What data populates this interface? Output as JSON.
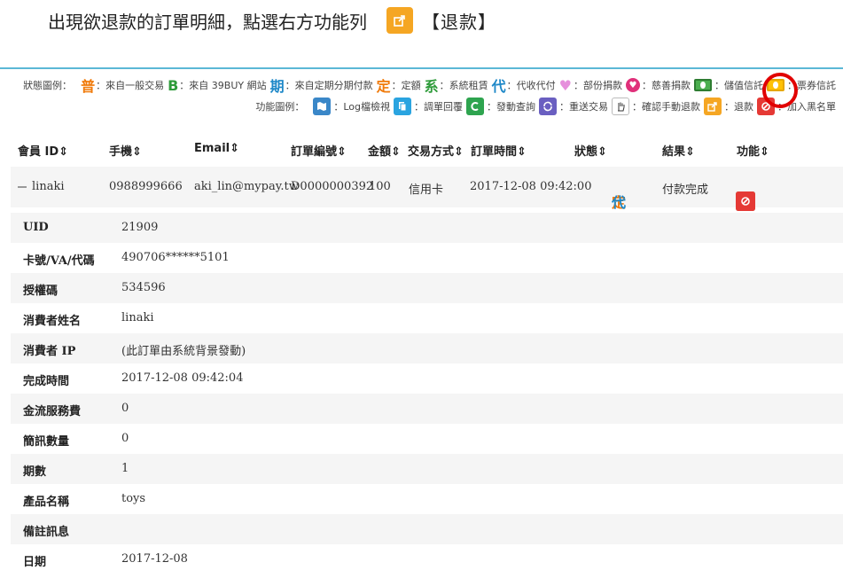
{
  "instruction": {
    "text": "出現欲退款的訂單明細，點選右方功能列",
    "refund_label": "【退款】"
  },
  "legend_status": {
    "label": "狀態圖例：",
    "items": [
      {
        "glyph": "普",
        "color": "#f07a0a",
        "text": "：來自一般交易"
      },
      {
        "glyph": "B",
        "color": "#2e9b3a",
        "text": "：來自 39BUY 網站"
      },
      {
        "glyph": "期",
        "color": "#1e88c8",
        "text": "：來自定期分期付款"
      },
      {
        "glyph": "定",
        "color": "#f07a0a",
        "text": "：定額"
      },
      {
        "glyph": "系",
        "color": "#2e9b3a",
        "text": "：系統租賃"
      },
      {
        "glyph": "代",
        "color": "#1e88c8",
        "text": "：代收代付"
      },
      {
        "glyph": "heart",
        "text": "：部份捐款"
      },
      {
        "glyph": "dot",
        "text": "：慈善捐款"
      },
      {
        "glyph": "money-green",
        "text": "：儲值信託"
      },
      {
        "glyph": "money-yellow",
        "text": "：票券信託"
      }
    ]
  },
  "legend_function": {
    "label": "功能圖例：",
    "items": [
      {
        "icon": "map-icon",
        "color": "#3a87c8",
        "text": "：Log檔檢視"
      },
      {
        "icon": "copy-icon",
        "color": "#2aa4e0",
        "text": "：調單回覆"
      },
      {
        "icon": "refresh-c-icon",
        "color": "#2ea44f",
        "text": "：發動查詢"
      },
      {
        "icon": "resend-icon",
        "color": "#6a5fc1",
        "text": "：重送交易"
      },
      {
        "icon": "hand-icon",
        "color": "#ffffff",
        "text": "：確認手動退款"
      },
      {
        "icon": "share-icon",
        "color": "#f5a623",
        "text": "：退款"
      },
      {
        "icon": "ban-icon",
        "color": "#e53935",
        "text": "：加入黑名單"
      }
    ]
  },
  "table": {
    "headers": [
      "會員 ID⇕",
      "手機⇕",
      "Email⇕",
      "訂單編號⇕",
      "金額⇕",
      "交易方式⇕",
      "訂單時間⇕",
      "狀態⇕",
      "結果⇕",
      "功能⇕"
    ],
    "row": {
      "member_id": "linaki",
      "phone": "0988999666",
      "email": "aki_lin@mypay.tw",
      "order_no": "D0000000392",
      "amount": "100",
      "method": "信用卡",
      "time": "2017-12-08 09:42:00",
      "status_1": "定",
      "status_2": "代",
      "result": "付款完成"
    }
  },
  "details": [
    {
      "key": "UID",
      "value": "21909"
    },
    {
      "key": "卡號/VA/代碼",
      "value": "490706******5101"
    },
    {
      "key": "授權碼",
      "value": "534596"
    },
    {
      "key": "消費者姓名",
      "value": "linaki"
    },
    {
      "key": "消費者 IP",
      "value": "(此訂單由系統背景發動)"
    },
    {
      "key": "完成時間",
      "value": "2017-12-08 09:42:04"
    },
    {
      "key": "金流服務費",
      "value": "0"
    },
    {
      "key": "簡訊數量",
      "value": "0"
    },
    {
      "key": "期數",
      "value": "1"
    },
    {
      "key": "產品名稱",
      "value": "toys"
    },
    {
      "key": "備註訊息",
      "value": ""
    },
    {
      "key": "日期",
      "value": "2017-12-08"
    }
  ]
}
